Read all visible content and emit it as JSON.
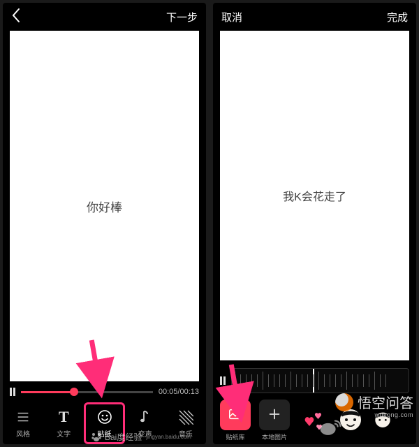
{
  "left": {
    "back_icon": "chevron-left",
    "next_label": "下一步",
    "canvas_text": "你好棒",
    "time_elapsed": "00:05",
    "time_total": "00:13",
    "progress_percent": 40,
    "tabs": [
      {
        "id": "style",
        "label": "风格",
        "icon": "sparkle"
      },
      {
        "id": "text",
        "label": "文字",
        "icon": "T"
      },
      {
        "id": "sticker",
        "label": "贴纸",
        "icon": "smile",
        "selected": true
      },
      {
        "id": "voice",
        "label": "变声",
        "icon": "note"
      },
      {
        "id": "music",
        "label": "音乐",
        "icon": "lines"
      }
    ]
  },
  "right": {
    "cancel_label": "取消",
    "done_label": "完成",
    "canvas_text": "我K会花走了",
    "lib": [
      {
        "id": "library",
        "label": "贴纸库",
        "icon": "image",
        "selected": true
      },
      {
        "id": "local",
        "label": "本地图片",
        "icon": "plus"
      }
    ],
    "sticker_previews": [
      "hearts",
      "face-1",
      "face-2"
    ]
  },
  "watermarks": {
    "baidu_text": "Bai度经验",
    "baidu_sub": "jingyan.baidu.com",
    "wukong_text": "悟空问答",
    "wukong_sub": "wukong.com"
  },
  "accent_color": "#ff3b5c",
  "arrow_color": "#ff2d78"
}
